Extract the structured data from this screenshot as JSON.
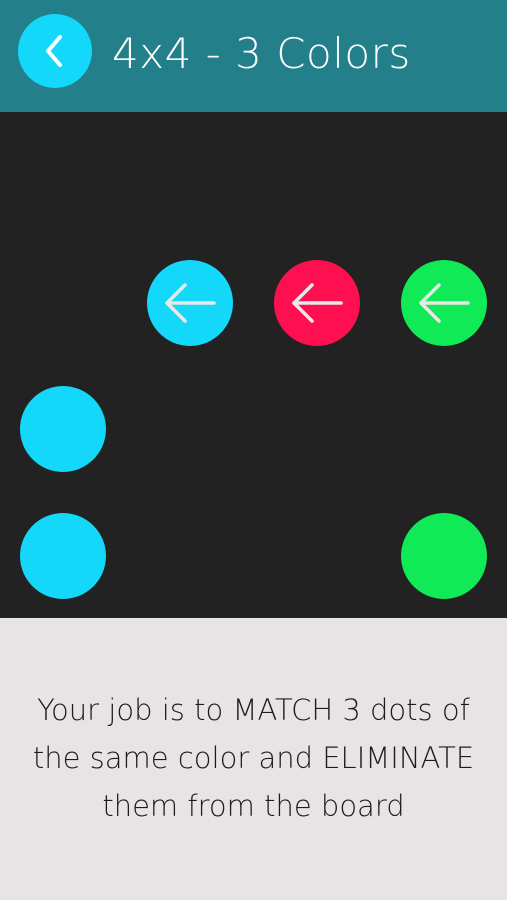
{
  "header": {
    "title": "4x4 - 3 Colors",
    "back_icon": "chevron-left-icon"
  },
  "colors": {
    "header_bg": "#237f89",
    "board_bg": "#222222",
    "panel_bg": "#e8e4e5",
    "cyan": "#13d8fa",
    "pink": "#fe1050",
    "green": "#10ea56",
    "arrow": "#e8e8e8"
  },
  "board": {
    "rows": 4,
    "columns": 4,
    "cells": [
      {
        "row": 2,
        "col": 2,
        "color": "cyan",
        "icon": "arrow-left-icon"
      },
      {
        "row": 2,
        "col": 3,
        "color": "pink",
        "icon": "arrow-left-icon"
      },
      {
        "row": 2,
        "col": 4,
        "color": "green",
        "icon": "arrow-left-icon"
      },
      {
        "row": 3,
        "col": 1,
        "color": "cyan",
        "icon": ""
      },
      {
        "row": 4,
        "col": 1,
        "color": "cyan",
        "icon": ""
      },
      {
        "row": 4,
        "col": 4,
        "color": "green",
        "icon": ""
      }
    ]
  },
  "instruction": {
    "text": "Your job is to MATCH 3 dots of the same color and ELIMINATE them from the board"
  }
}
